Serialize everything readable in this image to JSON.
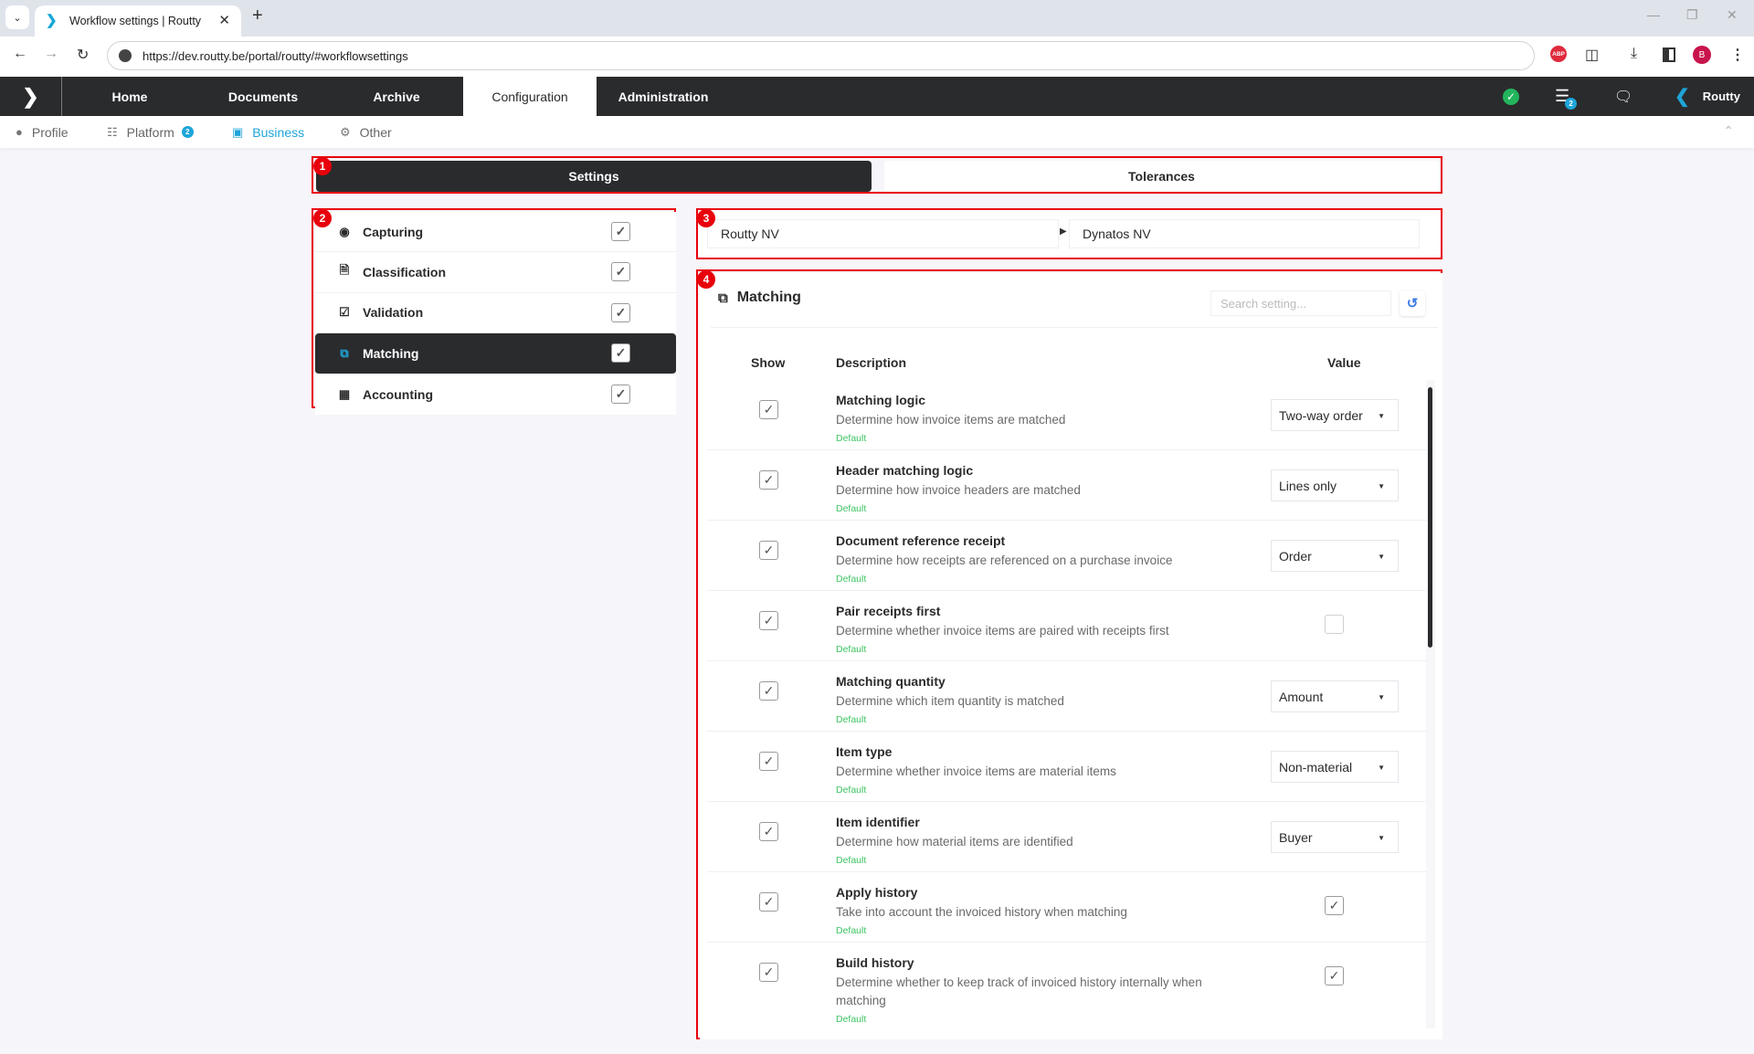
{
  "browser": {
    "tab_title": "Workflow settings | Routty",
    "url": "https://dev.routty.be/portal/routty/#workflowsettings",
    "profile_initial": "B",
    "adblock_label": "ABP"
  },
  "appnav": {
    "items": [
      {
        "label": "Home",
        "active": false
      },
      {
        "label": "Documents",
        "active": false
      },
      {
        "label": "Archive",
        "active": false
      },
      {
        "label": "Configuration",
        "active": true
      },
      {
        "label": "Administration",
        "active": false
      }
    ],
    "notifications_badge": "2",
    "brand_label": "Routty"
  },
  "subnav": {
    "items": [
      {
        "label": "Profile",
        "icon": "user-icon",
        "active": false
      },
      {
        "label": "Platform",
        "icon": "database-icon",
        "badge": "2",
        "active": false
      },
      {
        "label": "Business",
        "icon": "briefcase-icon",
        "active": true
      },
      {
        "label": "Other",
        "icon": "gear-icon",
        "active": false
      }
    ]
  },
  "annotations": [
    "1",
    "2",
    "3",
    "4"
  ],
  "segment_tabs": [
    {
      "label": "Settings",
      "active": true
    },
    {
      "label": "Tolerances",
      "active": false
    }
  ],
  "sections": [
    {
      "label": "Capturing",
      "icon": "camera-icon",
      "checked": true,
      "active": false
    },
    {
      "label": "Classification",
      "icon": "file-icon",
      "checked": true,
      "active": false
    },
    {
      "label": "Validation",
      "icon": "check-square-icon",
      "checked": true,
      "active": false
    },
    {
      "label": "Matching",
      "icon": "copy-icon",
      "checked": true,
      "active": true
    },
    {
      "label": "Accounting",
      "icon": "calculator-icon",
      "checked": true,
      "active": false
    }
  ],
  "breadcrumb": {
    "from": "Routty NV",
    "to": "Dynatos NV"
  },
  "panel": {
    "title": "Matching",
    "search_placeholder": "Search setting...",
    "columns": {
      "show": "Show",
      "description": "Description",
      "value": "Value"
    },
    "settings": [
      {
        "name": "Matching logic",
        "description": "Determine how invoice items are matched",
        "source": "Default",
        "show": true,
        "type": "select",
        "value": "Two-way order"
      },
      {
        "name": "Header matching logic",
        "description": "Determine how invoice headers are matched",
        "source": "Default",
        "show": true,
        "type": "select",
        "value": "Lines only"
      },
      {
        "name": "Document reference receipt",
        "description": "Determine how receipts are referenced on a purchase invoice",
        "source": "Default",
        "show": true,
        "type": "select",
        "value": "Order"
      },
      {
        "name": "Pair receipts first",
        "description": "Determine whether invoice items are paired with receipts first",
        "source": "Default",
        "show": true,
        "type": "checkbox",
        "value": false
      },
      {
        "name": "Matching quantity",
        "description": "Determine which item quantity is matched",
        "source": "Default",
        "show": true,
        "type": "select",
        "value": "Amount"
      },
      {
        "name": "Item type",
        "description": "Determine whether invoice items are material items",
        "source": "Default",
        "show": true,
        "type": "select",
        "value": "Non-material"
      },
      {
        "name": "Item identifier",
        "description": "Determine how material items are identified",
        "source": "Default",
        "show": true,
        "type": "select",
        "value": "Buyer"
      },
      {
        "name": "Apply history",
        "description": "Take into account the invoiced history when matching",
        "source": "Default",
        "show": true,
        "type": "checkbox",
        "value": true
      },
      {
        "name": "Build history",
        "description": "Determine whether to keep track of invoiced history internally when matching",
        "source": "Default",
        "show": true,
        "type": "checkbox",
        "value": true
      }
    ]
  },
  "colors": {
    "accent": "#1ea5d9",
    "nav_dark": "#2a2b2d",
    "annotation_red": "#e8000b",
    "default_green": "#3dc463",
    "reset_blue": "#3e7ce5"
  }
}
